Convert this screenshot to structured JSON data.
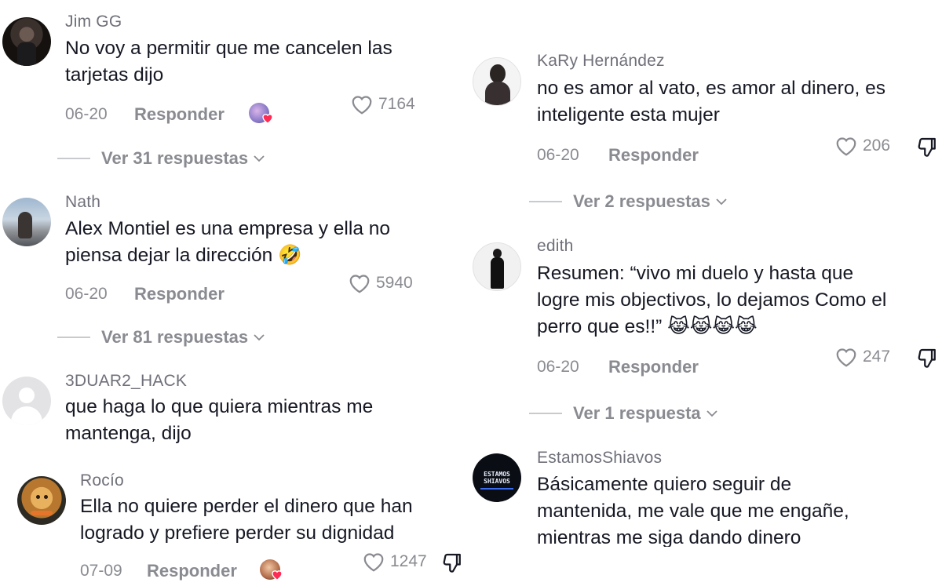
{
  "left": [
    {
      "username": "Jim GG",
      "text": [
        "No voy a permitir que me cancelen las",
        "tarjetas dijo"
      ],
      "date": "06-20",
      "reply": "Responder",
      "likes": "7164",
      "replies": "Ver 31 respuestas"
    },
    {
      "username": "Nath",
      "text": [
        "Alex Montiel es una empresa y ella no",
        "piensa dejar la dirección 🤣"
      ],
      "date": "06-20",
      "reply": "Responder",
      "likes": "5940",
      "replies": "Ver 81 respuestas"
    },
    {
      "username": "3DUAR2_HACK",
      "text": [
        "que haga lo que quiera mientras me",
        "mantenga, dijo"
      ]
    },
    {
      "username": "Rocío",
      "text": [
        "Ella no quiere perder el dinero que han",
        "logrado y prefiere perder su dignidad"
      ],
      "date": "07-09",
      "reply": "Responder",
      "likes": "1247"
    }
  ],
  "right": [
    {
      "username": "KaRy Hernández",
      "text": [
        "no es amor al vato, es amor al dinero, es",
        "inteligente esta mujer"
      ],
      "date": "06-20",
      "reply": "Responder",
      "likes": "206",
      "replies": "Ver 2 respuestas"
    },
    {
      "username": "edith",
      "text": [
        "Resumen: “vivo mi duelo y hasta que",
        "logre mis objectivos, lo dejamos Como el",
        "perro que es!!” 😹😹😹😹"
      ],
      "date": "06-20",
      "reply": "Responder",
      "likes": "247",
      "replies": "Ver 1 respuesta"
    },
    {
      "username": "EstamosShiavos",
      "avatar_text": [
        "ESTAMOS",
        "SHIAVOS"
      ],
      "text": [
        "Básicamente quiero seguir de",
        "mantenida, me vale que me engañe,",
        "mientras me siga dando dinero"
      ]
    }
  ]
}
